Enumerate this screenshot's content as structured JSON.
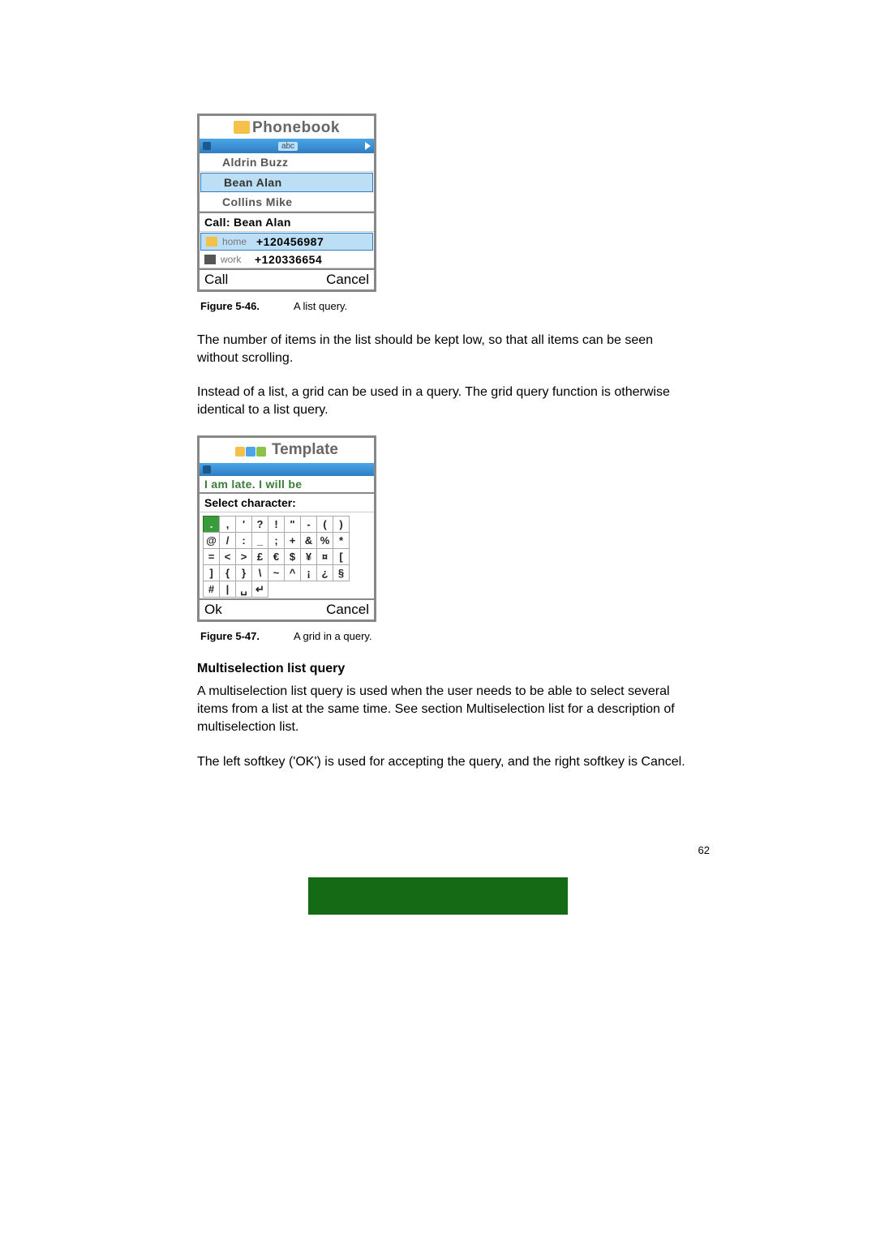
{
  "phonebook": {
    "title": "Phonebook",
    "navbar_abc": "abc",
    "list": [
      {
        "name": "Aldrin Buzz"
      },
      {
        "name": "Bean Alan"
      },
      {
        "name": "Collins Mike"
      }
    ],
    "call_header": "Call: Bean Alan",
    "numbers": [
      {
        "type": "home",
        "label": "home",
        "number": "+120456987"
      },
      {
        "type": "work",
        "label": "work",
        "number": "+120336654"
      }
    ],
    "softkey_left": "Call",
    "softkey_right": "Cancel"
  },
  "caption1": {
    "label": "Figure 5-46.",
    "text": "A list query."
  },
  "para1": "The number of items in the list should be kept low, so that all items can be seen without scrolling.",
  "para2": "Instead of a list, a grid can be used in a query. The grid query function is otherwise identical to a list query.",
  "template": {
    "title": "Template",
    "editor_line": "I am late. I will be",
    "select_header": "Select character:",
    "grid": [
      [
        ".",
        ",",
        "'",
        "?",
        "!",
        "\"",
        "-",
        "(",
        ")"
      ],
      [
        "@",
        "/",
        ":",
        "_",
        ";",
        "+",
        "&",
        "%",
        "*"
      ],
      [
        "=",
        "<",
        ">",
        "£",
        "€",
        "$",
        "¥",
        "¤",
        "["
      ],
      [
        "]",
        "{",
        "}",
        "\\",
        "~",
        "^",
        "¡",
        "¿",
        "§"
      ],
      [
        "#",
        "|",
        "␣",
        "↵",
        "",
        "",
        "",
        "",
        ""
      ]
    ],
    "softkey_left": "Ok",
    "softkey_right": "Cancel"
  },
  "caption2": {
    "label": "Figure 5-47.",
    "text": "A grid in a query."
  },
  "subhead": "Multiselection list query",
  "para3": "A multiselection list query is used when the user needs to be able to select several items from a list at the same time. See section Multiselection list for a description of multiselection list.",
  "para4": "The left softkey ('OK') is used for accepting the query, and the right softkey is Cancel.",
  "page_number": "62"
}
